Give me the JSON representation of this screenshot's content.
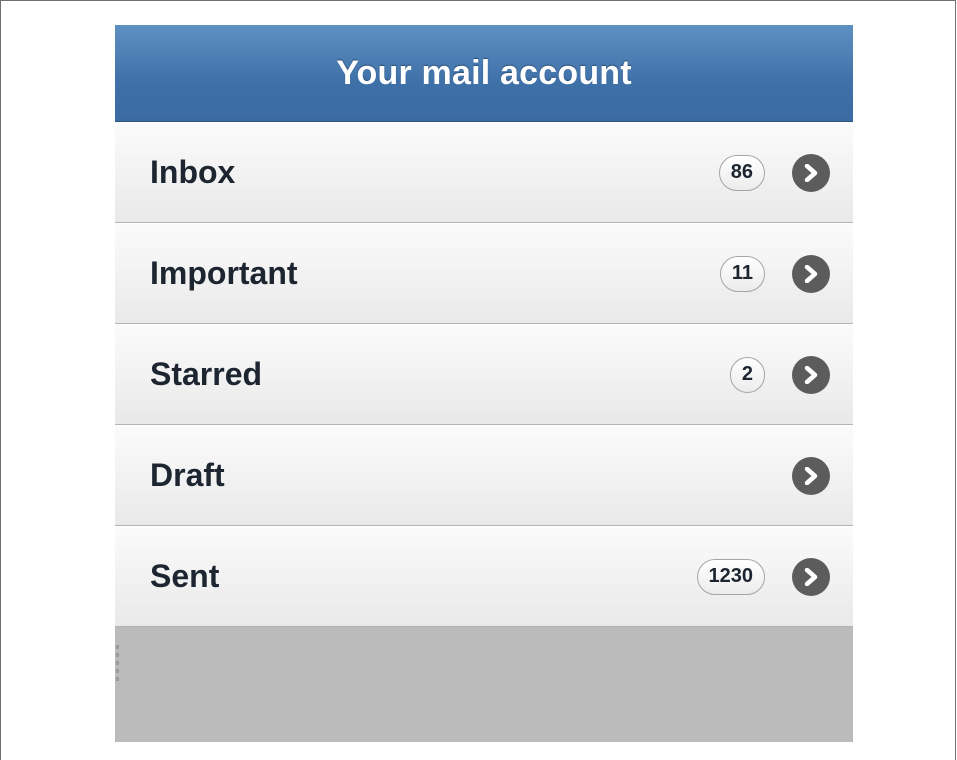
{
  "header": {
    "title": "Your mail account"
  },
  "folders": [
    {
      "label": "Inbox",
      "count": "86",
      "icon": "chevron-right-icon"
    },
    {
      "label": "Important",
      "count": "11",
      "icon": "chevron-right-icon"
    },
    {
      "label": "Starred",
      "count": "2",
      "icon": "chevron-right-icon"
    },
    {
      "label": "Draft",
      "count": "",
      "icon": "chevron-right-icon"
    },
    {
      "label": "Sent",
      "count": "1230",
      "icon": "chevron-right-icon"
    }
  ],
  "colors": {
    "header_blue": "#4a7db3",
    "row_background": "#f2f2f2",
    "chevron": "#5c5c5c",
    "page_background": "#bbbbbb"
  }
}
